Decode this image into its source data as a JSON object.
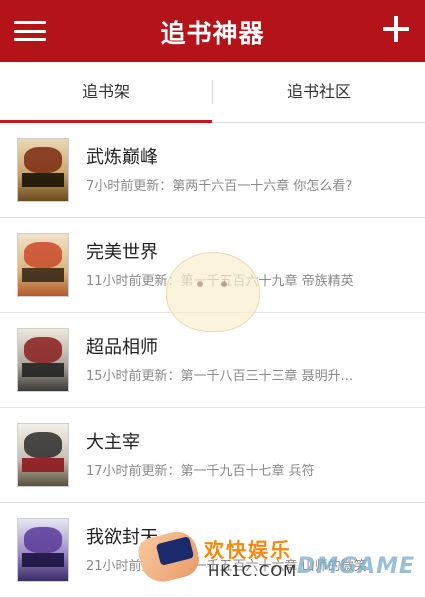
{
  "header": {
    "title": "追书神器",
    "menu_icon": "hamburger-menu-icon",
    "add_icon": "plus-icon",
    "color": "#b5131a"
  },
  "tabs": [
    {
      "label": "追书架",
      "active": true
    },
    {
      "label": "追书社区",
      "active": false
    }
  ],
  "books": [
    {
      "title": "武炼巅峰",
      "update": "7小时前更新：第两千六百一十六章 你怎么看?"
    },
    {
      "title": "完美世界",
      "update": "11小时前更新：第一千五百六十九章 帝族精英"
    },
    {
      "title": "超品相师",
      "update": "15小时前更新：第一千八百三十三章 聂明升..."
    },
    {
      "title": "大主宰",
      "update": "17小时前更新：第一千九百十七章 兵符"
    },
    {
      "title": "我欲封天",
      "update": "21小时前更新：第一千五百六十六章 山师的微笑"
    }
  ],
  "watermark": {
    "brand": "欢快娱乐",
    "site": "HK1C.COM",
    "dm": "DMGAME"
  }
}
